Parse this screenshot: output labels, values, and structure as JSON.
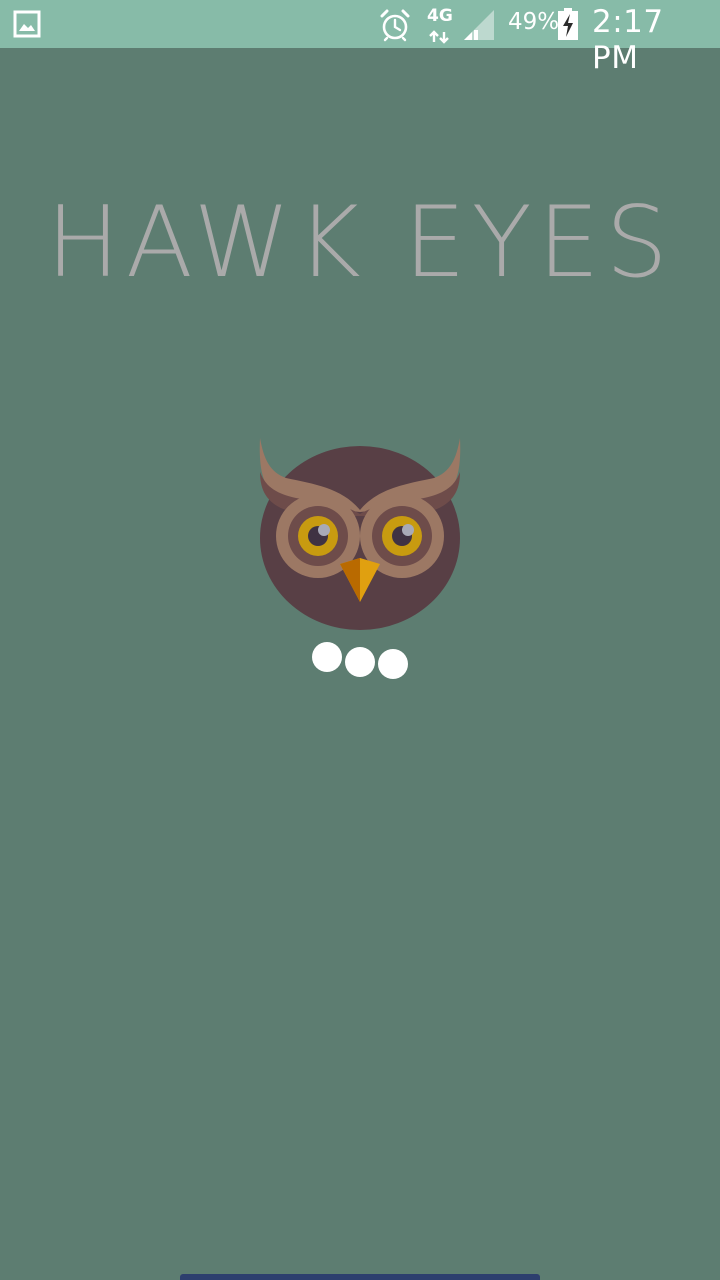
{
  "status_bar": {
    "left_icon": "gallery-icon",
    "alarm_icon": "alarm-icon",
    "network_label": "4G",
    "signal_icon": "signal-icon",
    "battery_percent": "49%",
    "battery_icon": "battery-charging-icon",
    "time": "2:17 PM",
    "background_color": "#87bba8"
  },
  "splash": {
    "title": "HAWK EYES",
    "title_color": "#aaaaaa",
    "background_color": "#5d7d71",
    "logo_icon": "owl-icon",
    "loading_indicator": "loading-dots-icon"
  }
}
